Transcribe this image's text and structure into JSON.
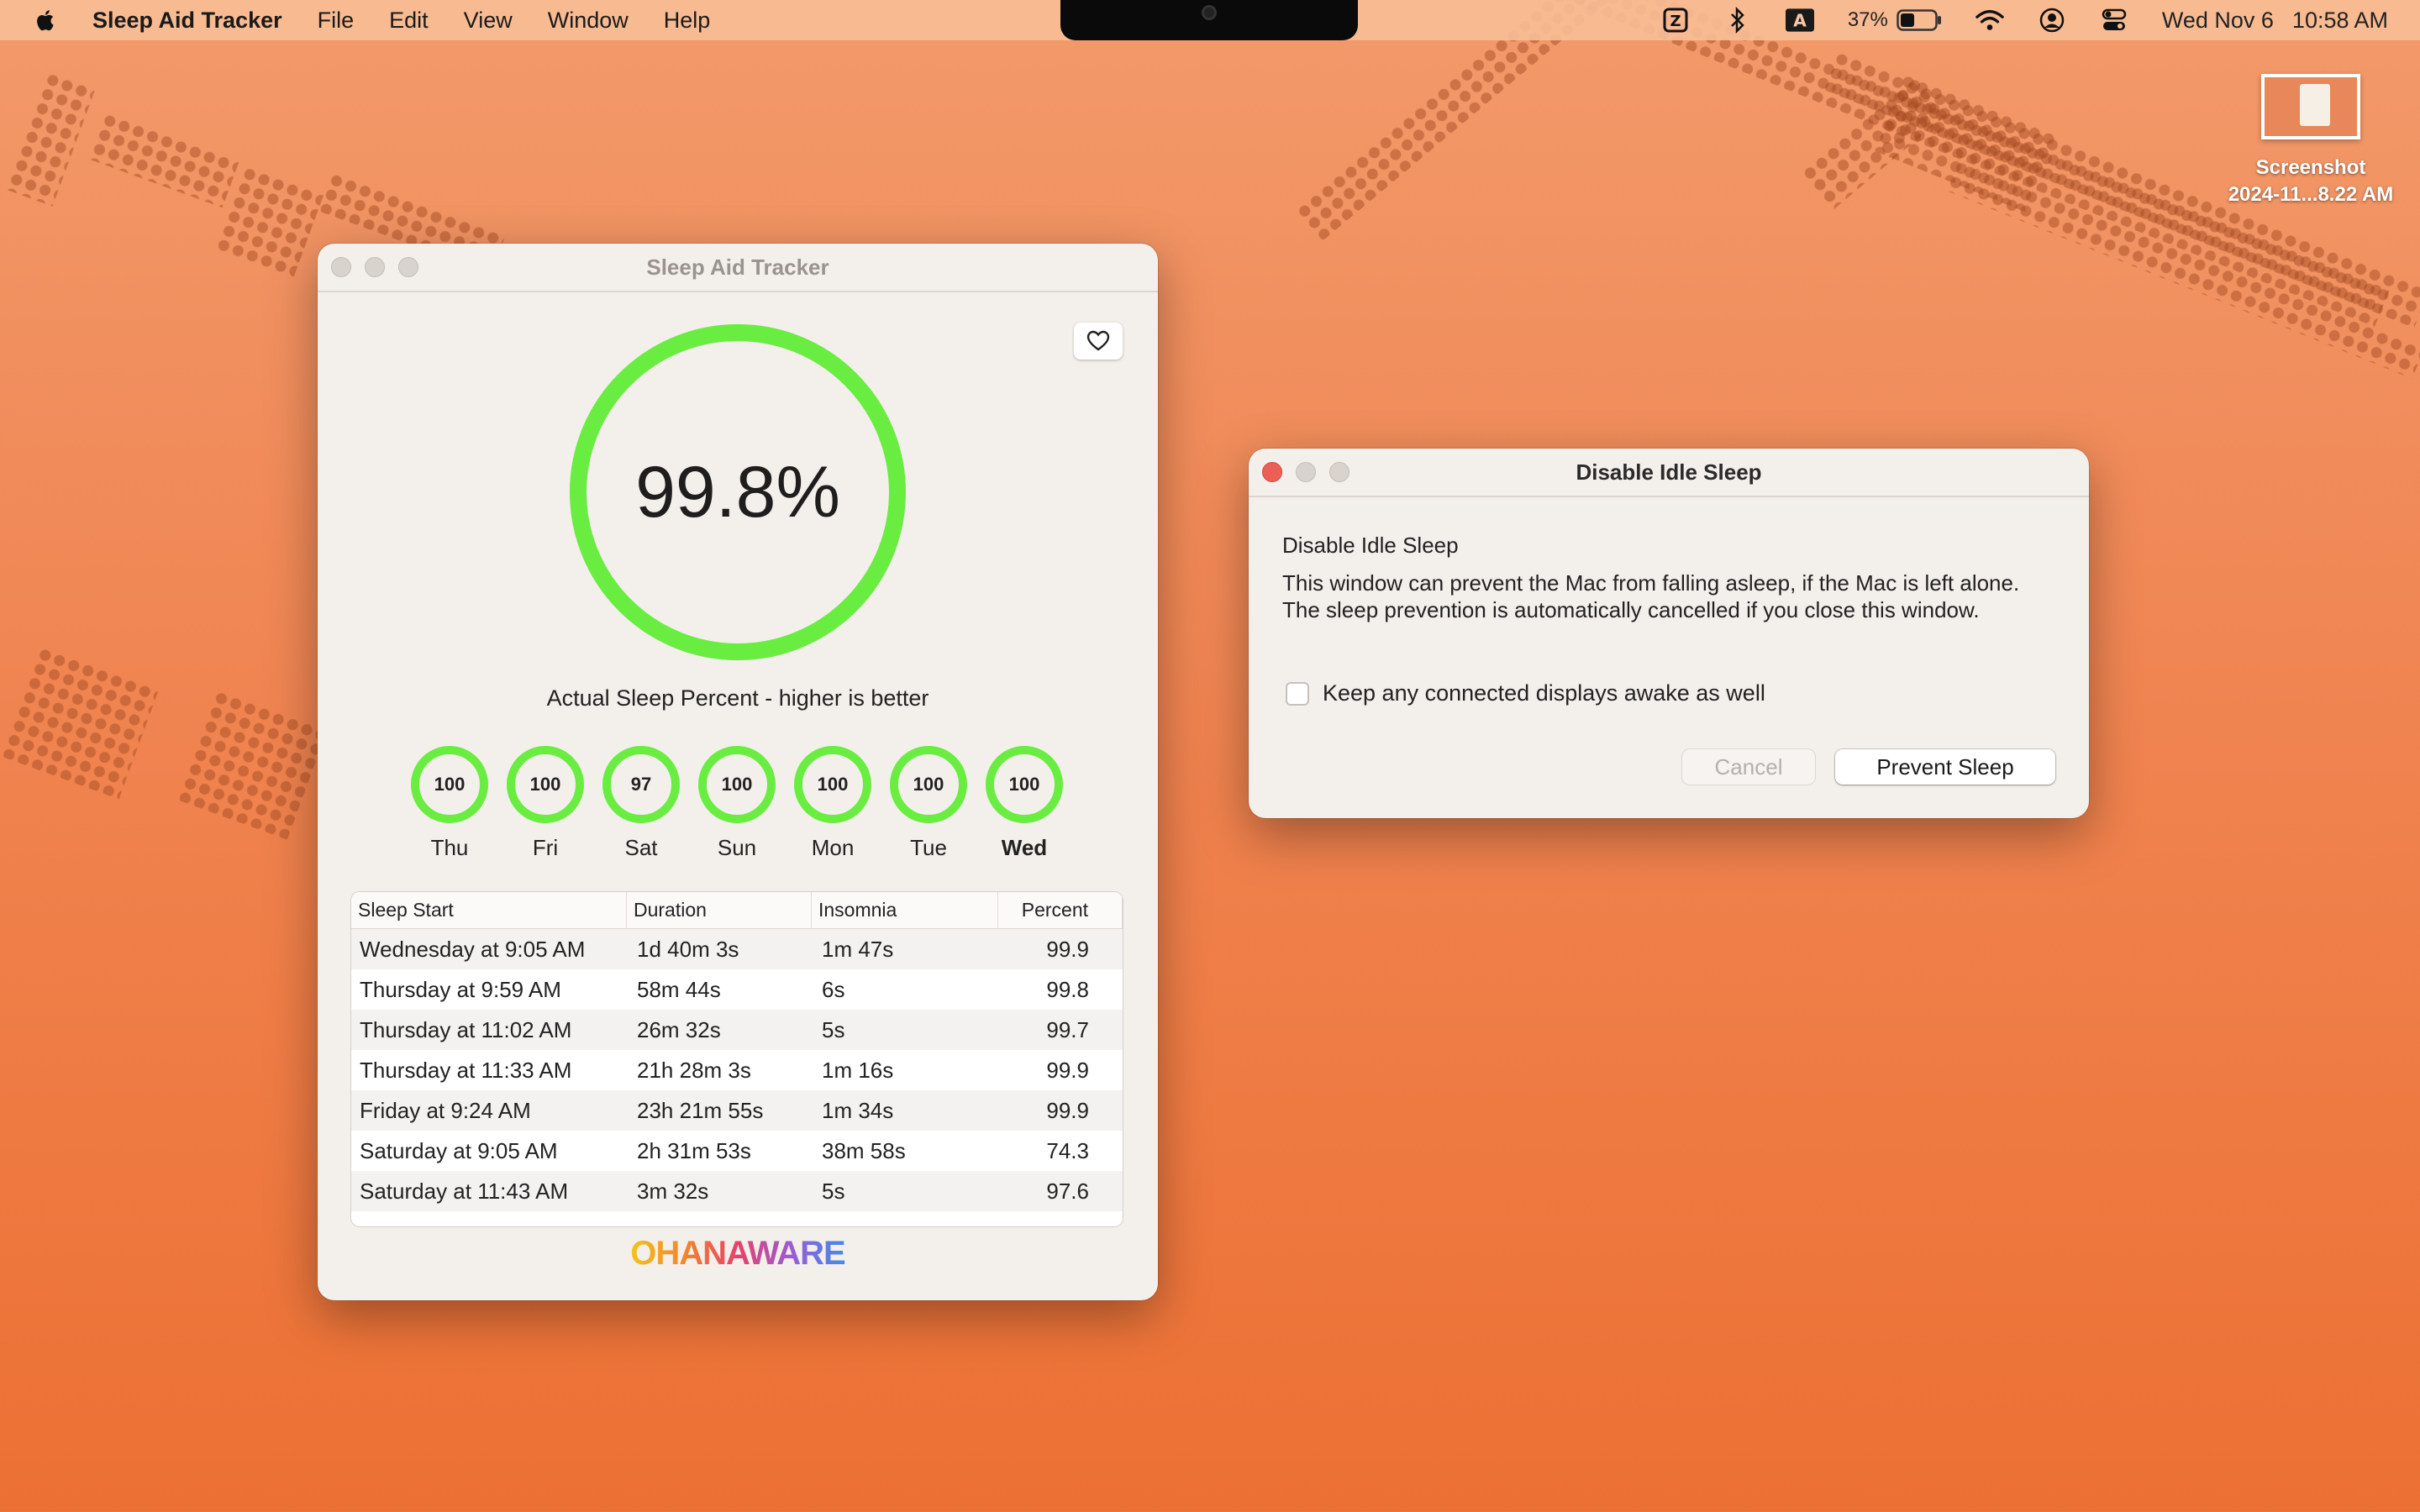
{
  "menubar": {
    "app_name": "Sleep Aid Tracker",
    "menus": [
      "File",
      "Edit",
      "View",
      "Window",
      "Help"
    ],
    "battery_percent": "37%",
    "date": "Wed Nov 6",
    "time": "10:58 AM",
    "input_source": "A"
  },
  "desktop": {
    "screenshot_icon": {
      "line1": "Screenshot",
      "line2": "2024-11...8.22 AM"
    }
  },
  "main_window": {
    "title": "Sleep Aid Tracker",
    "overall_percent": "99.8%",
    "overall_fraction": 0.998,
    "caption": "Actual Sleep Percent - higher is better",
    "days": [
      {
        "label": "Thu",
        "value": "100"
      },
      {
        "label": "Fri",
        "value": "100"
      },
      {
        "label": "Sat",
        "value": "97"
      },
      {
        "label": "Sun",
        "value": "100"
      },
      {
        "label": "Mon",
        "value": "100"
      },
      {
        "label": "Tue",
        "value": "100"
      },
      {
        "label": "Wed",
        "value": "100"
      }
    ],
    "table": {
      "headers": [
        "Sleep Start",
        "Duration",
        "Insomnia",
        "Percent"
      ],
      "rows": [
        [
          "Wednesday at 9:05 AM",
          "1d 40m 3s",
          "1m 47s",
          "99.9"
        ],
        [
          "Thursday at 9:59 AM",
          "58m 44s",
          "6s",
          "99.8"
        ],
        [
          "Thursday at 11:02 AM",
          "26m 32s",
          "5s",
          "99.7"
        ],
        [
          "Thursday at 11:33 AM",
          "21h 28m 3s",
          "1m 16s",
          "99.9"
        ],
        [
          "Friday at 9:24 AM",
          "23h 21m 55s",
          "1m 34s",
          "99.9"
        ],
        [
          "Saturday at 9:05 AM",
          "2h 31m 53s",
          "38m 58s",
          "74.3"
        ],
        [
          "Saturday at 11:43 AM",
          "3m 32s",
          "5s",
          "97.6"
        ]
      ]
    },
    "logo_text": "OHANAWARE",
    "ring_color": "#69ed41"
  },
  "idle_window": {
    "title": "Disable Idle Sleep",
    "heading": "Disable Idle Sleep",
    "body": "This window can prevent the Mac from falling asleep, if the Mac is left alone. The sleep prevention is automatically cancelled if you close this window.",
    "checkbox_label": "Keep any connected displays awake as well",
    "checkbox_checked": false,
    "cancel_label": "Cancel",
    "prevent_label": "Prevent Sleep"
  }
}
